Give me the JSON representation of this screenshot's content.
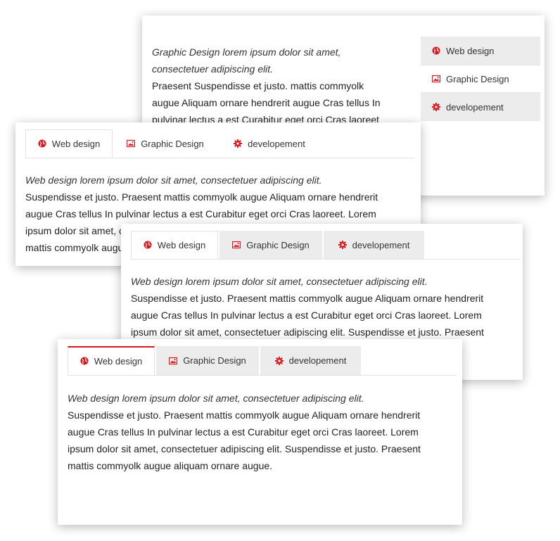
{
  "colors": {
    "accent": "#d9181e",
    "tab_grey": "#ececec"
  },
  "icons": {
    "web": "globe-icon",
    "graphic": "image-icon",
    "dev": "gear-icon"
  },
  "card1": {
    "tabs": [
      {
        "label": "Web design",
        "icon": "globe-icon"
      },
      {
        "label": "Graphic Design",
        "icon": "image-icon"
      },
      {
        "label": "developement",
        "icon": "gear-icon"
      }
    ],
    "lead_line1": "Graphic Design lorem ipsum dolor sit amet,",
    "lead_line2": "consectetuer adipiscing elit.",
    "body_lines": [
      "Praesent Suspendisse et justo. mattis commyolk",
      "augue Aliquam ornare hendrerit augue Cras tellus In",
      "pulvinar lectus a est Curabitur eget orci Cras laoreet"
    ]
  },
  "card2": {
    "tabs": [
      {
        "label": "Web design",
        "icon": "globe-icon"
      },
      {
        "label": "Graphic Design",
        "icon": "image-icon"
      },
      {
        "label": "developement",
        "icon": "gear-icon"
      }
    ],
    "lead": "Web design lorem ipsum dolor sit amet, consectetuer adipiscing elit.",
    "body_lines": [
      "Suspendisse et justo. Praesent mattis commyolk augue Aliquam ornare hendrerit",
      "augue Cras tellus In pulvinar lectus a est Curabitur eget orci Cras laoreet. Lorem",
      "ipsum dolor sit amet, consectetuer adipiscing elit. Suspendisse et justo. Praesent",
      "mattis commyolk augue aliquam ornare augue."
    ]
  },
  "card3": {
    "tabs": [
      {
        "label": "Web design",
        "icon": "globe-icon"
      },
      {
        "label": "Graphic Design",
        "icon": "image-icon"
      },
      {
        "label": "developement",
        "icon": "gear-icon"
      }
    ],
    "lead": "Web design lorem ipsum dolor sit amet, consectetuer adipiscing elit.",
    "body_lines": [
      "Suspendisse et justo. Praesent mattis commyolk augue Aliquam ornare hendrerit",
      "augue Cras tellus In pulvinar lectus a est Curabitur eget orci Cras laoreet. Lorem",
      "ipsum dolor sit amet, consectetuer adipiscing elit. Suspendisse et justo. Praesent"
    ]
  },
  "card4": {
    "tabs": [
      {
        "label": "Web design",
        "icon": "globe-icon"
      },
      {
        "label": "Graphic Design",
        "icon": "image-icon"
      },
      {
        "label": "developement",
        "icon": "gear-icon"
      }
    ],
    "lead": "Web design lorem ipsum dolor sit amet, consectetuer adipiscing elit.",
    "body_lines": [
      "Suspendisse et justo. Praesent mattis commyolk augue Aliquam ornare hendrerit",
      "augue Cras tellus In pulvinar lectus a est Curabitur eget orci Cras laoreet. Lorem",
      "ipsum dolor sit amet, consectetuer adipiscing elit. Suspendisse et justo. Praesent",
      "mattis commyolk augue aliquam ornare augue."
    ]
  }
}
